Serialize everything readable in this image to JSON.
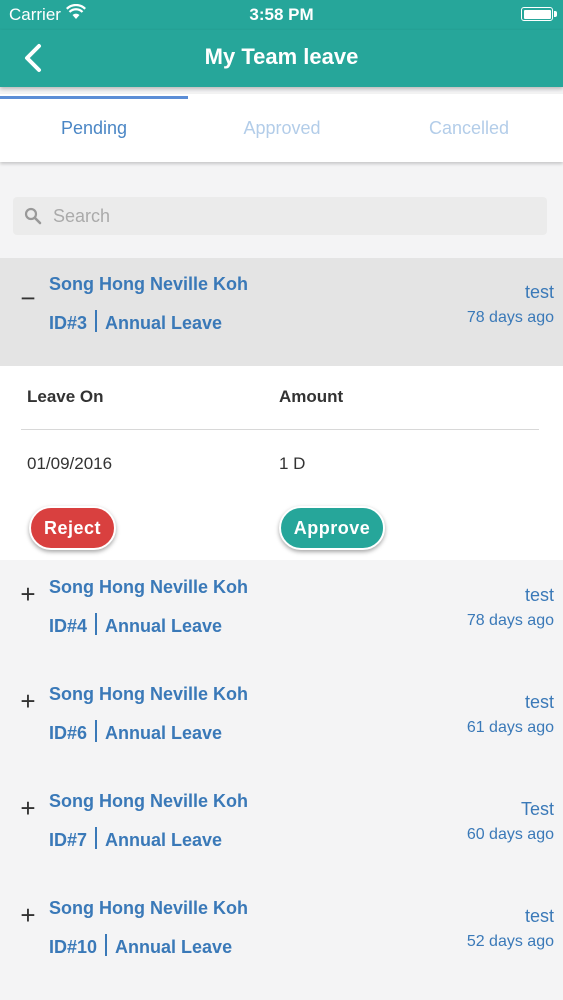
{
  "status_bar": {
    "carrier": "Carrier",
    "time": "3:58 PM"
  },
  "nav": {
    "title": "My Team leave",
    "back_icon": "chevron-left-icon"
  },
  "tabs": [
    {
      "label": "Pending",
      "active": true
    },
    {
      "label": "Approved",
      "active": false
    },
    {
      "label": "Cancelled",
      "active": false
    }
  ],
  "search": {
    "placeholder": "Search",
    "value": ""
  },
  "leaves": [
    {
      "name": "Song Hong Neville Koh",
      "id": "ID#3",
      "type": "Annual Leave",
      "reason": "test",
      "ago": "78 days ago",
      "toggle": "−",
      "expanded": true
    },
    {
      "name": "Song Hong Neville Koh",
      "id": "ID#4",
      "type": "Annual Leave",
      "reason": "test",
      "ago": "78 days ago",
      "toggle": "+",
      "expanded": false
    },
    {
      "name": "Song Hong Neville Koh",
      "id": "ID#6",
      "type": "Annual Leave",
      "reason": "test",
      "ago": "61 days ago",
      "toggle": "+",
      "expanded": false
    },
    {
      "name": "Song Hong Neville Koh",
      "id": "ID#7",
      "type": "Annual Leave",
      "reason": "Test",
      "ago": "60 days ago",
      "toggle": "+",
      "expanded": false
    },
    {
      "name": "Song Hong Neville Koh",
      "id": "ID#10",
      "type": "Annual Leave",
      "reason": "test",
      "ago": "52 days ago",
      "toggle": "+",
      "expanded": false
    }
  ],
  "details": {
    "col_leave_on": "Leave On",
    "col_amount": "Amount",
    "leave_on": "01/09/2016",
    "amount": "1 D",
    "reject_label": "Reject",
    "approve_label": "Approve"
  },
  "colors": {
    "primary": "#26a69a",
    "reject": "#d9403f",
    "link": "#3a79b8",
    "tab_active": "#4a86c5"
  }
}
